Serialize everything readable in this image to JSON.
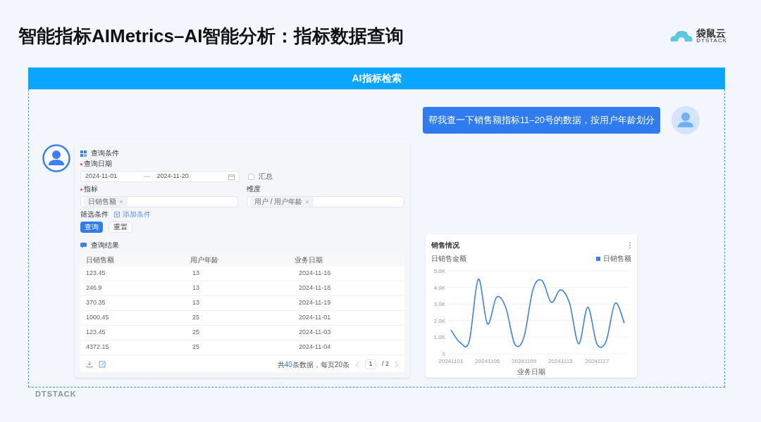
{
  "title": "智能指标AIMetrics–AI智能分析：指标数据查询",
  "logo": {
    "name": "袋鼠云",
    "sub": "DTSTACK"
  },
  "header": "AI指标检索",
  "user_message": "帮我查一下销售额指标11–20号的数据，按用户年龄划分",
  "query_panel": {
    "section_title": "查询条件",
    "date_label": "查询日期",
    "date_start": "2024-11-01",
    "date_end": "2024-11-20",
    "summary": {
      "label": "汇总",
      "checked": false
    },
    "metric_label": "指标",
    "metric_tag": "日销售额",
    "dimension_label": "维度",
    "dimension_tag": "用户 / 用户年龄",
    "filter_label": "筛选条件",
    "add_filter": "添加条件",
    "buttons": [
      {
        "label": "查询",
        "primary": true
      },
      {
        "label": "重置",
        "primary": false
      }
    ],
    "results_title": "查询结果",
    "table": {
      "columns": [
        "日销售额",
        "用户年龄",
        "业务日期"
      ],
      "rows": [
        [
          "123.45",
          "13",
          "2024-11-16"
        ],
        [
          "246.9",
          "13",
          "2024-11-18"
        ],
        [
          "370.35",
          "13",
          "2024-11-19"
        ],
        [
          "1000.45",
          "25",
          "2024-11-01"
        ],
        [
          "123.45",
          "25",
          "2024-11-03"
        ],
        [
          "4372.15",
          "25",
          "2024-11-04"
        ]
      ]
    },
    "pagination": {
      "total_prefix": "共",
      "total": "40",
      "total_suffix": "条数据，每页20条",
      "page": "1",
      "pages": "/ 2"
    }
  },
  "chart": {
    "title": "销售情况",
    "chart_data": {
      "type": "line",
      "ylabel": "日销售金额",
      "xlabel": "业务日期",
      "categories": [
        "20241101",
        null,
        null,
        null,
        "20241105",
        null,
        null,
        null,
        "20241109",
        null,
        null,
        null,
        "20241113",
        null,
        null,
        null,
        "20241117",
        null,
        null,
        null
      ],
      "grid": true,
      "series": [
        {
          "name": "日销售额",
          "color": "#3b7ff0",
          "values": [
            1430,
            680,
            750,
            4500,
            1800,
            3400,
            2800,
            580,
            1000,
            3900,
            4400,
            3100,
            3850,
            3050,
            600,
            2800,
            600,
            750,
            3050,
            1850
          ]
        }
      ],
      "ylim": [
        0,
        5000
      ],
      "yticks": [
        {
          "value": 0,
          "label": "0"
        },
        {
          "value": 1000,
          "label": "1.0K"
        },
        {
          "value": 2000,
          "label": "2.0K"
        },
        {
          "value": 3000,
          "label": "3.0K"
        },
        {
          "value": 4000,
          "label": "4.0K"
        },
        {
          "value": 5000,
          "label": "5.0K"
        }
      ]
    }
  },
  "footer": "DTSTACK"
}
